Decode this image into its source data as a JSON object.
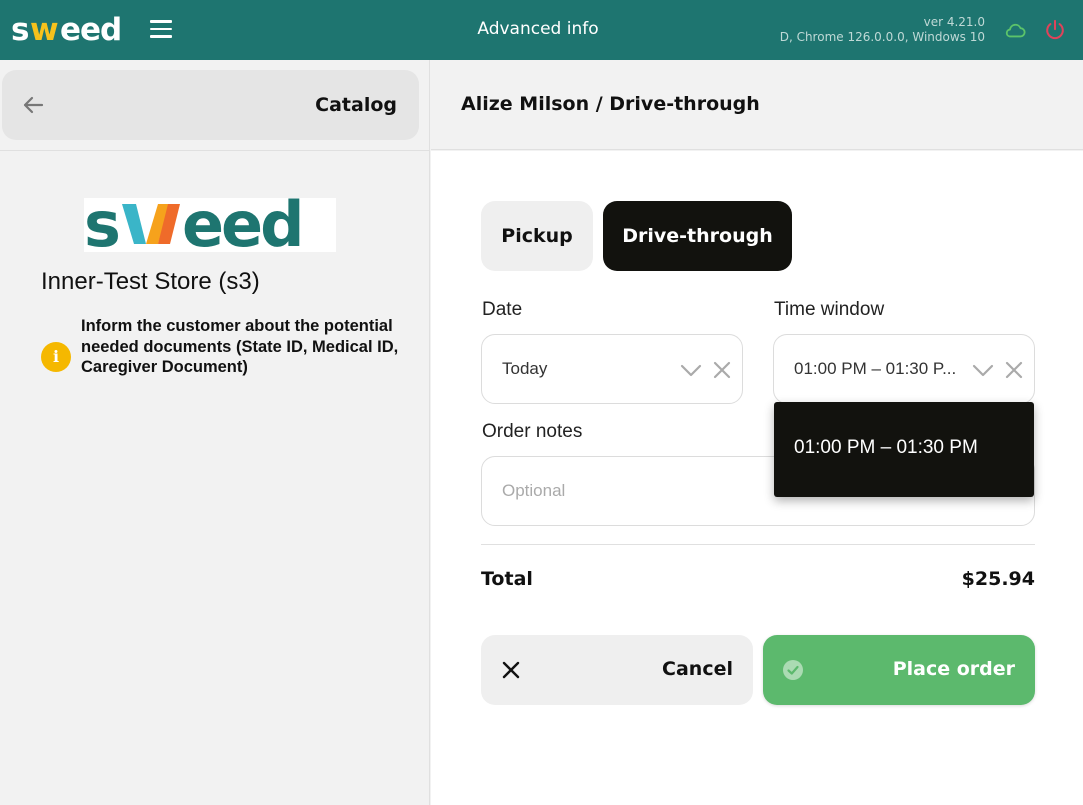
{
  "topbar": {
    "logo_text": "sweed",
    "title": "Advanced info",
    "version_line1": "ver 4.21.0",
    "version_line2": "D, Chrome 126.0.0.0, Windows 10",
    "background": "#1e7570",
    "icons": [
      "menu-icon",
      "cloud-icon",
      "power-icon"
    ]
  },
  "left": {
    "catalog_label": "Catalog",
    "store_logo_text": "sweed",
    "store_name": "Inner-Test Store (s3)",
    "info_icon_glyph": "i",
    "info_message": "Inform the customer about the potential needed documents (State ID, Medical ID, Caregiver Document)"
  },
  "right": {
    "header_title": "Alize Milson / Drive-through",
    "tabs": [
      {
        "label": "Pickup",
        "selected": false
      },
      {
        "label": "Drive-through",
        "selected": true
      }
    ],
    "date": {
      "label": "Date",
      "value": "Today"
    },
    "time_window": {
      "label": "Time window",
      "value": "01:00 PM – 01:30 P...",
      "options": [
        "01:00 PM – 01:30 PM"
      ]
    },
    "order_notes": {
      "label": "Order notes",
      "placeholder": "Optional"
    },
    "total": {
      "label": "Total",
      "value": "$25.94"
    },
    "cancel_label": "Cancel",
    "place_order_label": "Place order"
  },
  "colors": {
    "brand_teal": "#1e7570",
    "selected_tab": "#12120e",
    "place_order_green": "#5cb96d",
    "info_yellow": "#f5b800",
    "power_red": "#e0435a",
    "cloud_green": "#5cc46a"
  }
}
